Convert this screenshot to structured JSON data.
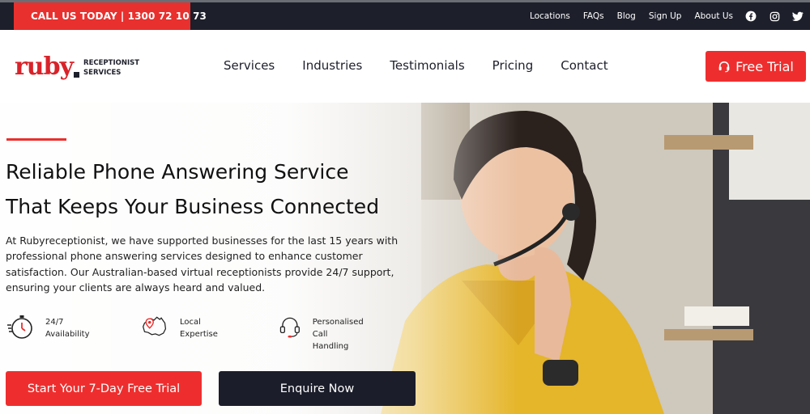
{
  "topbar": {
    "call_label": "CALL US TODAY | 1300 72 10 73",
    "links": [
      "Locations",
      "FAQs",
      "Blog",
      "Sign Up",
      "About Us"
    ],
    "social_icons": [
      "facebook-icon",
      "instagram-icon",
      "twitter-icon"
    ]
  },
  "logo": {
    "word": "ruby",
    "sub": "RECEPTIONIST\nSERVICES"
  },
  "nav": {
    "items": [
      "Services",
      "Industries",
      "Testimonials",
      "Pricing",
      "Contact"
    ],
    "cta_label": "Free Trial"
  },
  "hero": {
    "headline_line1": "Reliable Phone Answering Service",
    "headline_line2": "That Keeps Your Business Connected",
    "intro": "At Rubyreceptionist, we have supported businesses for the last 15 years with professional phone answering services designed to enhance customer satisfaction. Our Australian-based virtual receptionists provide 24/7 support, ensuring your clients are always heard and valued.",
    "features": [
      {
        "icon": "stopwatch-icon",
        "label": "24/7\nAvailability"
      },
      {
        "icon": "australia-map-icon",
        "label": "Local\nExpertise"
      },
      {
        "icon": "headset-icon",
        "label": "Personalised Call\nHandling"
      }
    ],
    "cta_primary": "Start Your 7-Day Free Trial",
    "cta_secondary": "Enquire Now"
  },
  "colors": {
    "accent": "#ee2e2e",
    "dark": "#1d1f2b"
  }
}
